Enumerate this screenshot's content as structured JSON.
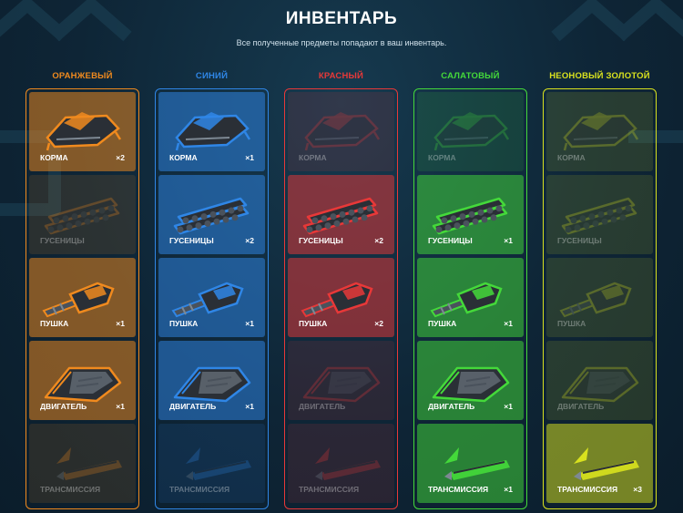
{
  "header": {
    "title": "ИНВЕНТАРЬ",
    "subtitle": "Все полученные предметы попадают в ваш инвентарь."
  },
  "columns": [
    {
      "label": "ОРАНЖЕВЫЙ",
      "color": "#f08a1e",
      "items": [
        {
          "name": "КОРМА",
          "count": "×2",
          "owned": true,
          "icon": "hull-icon"
        },
        {
          "name": "ГУСЕНИЦЫ",
          "count": "",
          "owned": false,
          "icon": "tracks-icon"
        },
        {
          "name": "ПУШКА",
          "count": "×1",
          "owned": true,
          "icon": "cannon-icon"
        },
        {
          "name": "ДВИГАТЕЛЬ",
          "count": "×1",
          "owned": true,
          "icon": "engine-icon"
        },
        {
          "name": "ТРАНСМИССИЯ",
          "count": "",
          "owned": false,
          "icon": "transmission-icon"
        }
      ]
    },
    {
      "label": "СИНИЙ",
      "color": "#2f86e6",
      "items": [
        {
          "name": "КОРМА",
          "count": "×1",
          "owned": true,
          "icon": "hull-icon"
        },
        {
          "name": "ГУСЕНИЦЫ",
          "count": "×2",
          "owned": true,
          "icon": "tracks-icon"
        },
        {
          "name": "ПУШКА",
          "count": "×1",
          "owned": true,
          "icon": "cannon-icon"
        },
        {
          "name": "ДВИГАТЕЛЬ",
          "count": "×1",
          "owned": true,
          "icon": "engine-icon"
        },
        {
          "name": "ТРАНСМИССИЯ",
          "count": "",
          "owned": false,
          "icon": "transmission-icon"
        }
      ]
    },
    {
      "label": "КРАСНЫЙ",
      "color": "#e83838",
      "items": [
        {
          "name": "КОРМА",
          "count": "",
          "owned": false,
          "icon": "hull-icon"
        },
        {
          "name": "ГУСЕНИЦЫ",
          "count": "×2",
          "owned": true,
          "icon": "tracks-icon"
        },
        {
          "name": "ПУШКА",
          "count": "×2",
          "owned": true,
          "icon": "cannon-icon"
        },
        {
          "name": "ДВИГАТЕЛЬ",
          "count": "",
          "owned": false,
          "icon": "engine-icon"
        },
        {
          "name": "ТРАНСМИССИЯ",
          "count": "",
          "owned": false,
          "icon": "transmission-icon"
        }
      ]
    },
    {
      "label": "САЛАТОВЫЙ",
      "color": "#44d93a",
      "items": [
        {
          "name": "КОРМА",
          "count": "",
          "owned": false,
          "icon": "hull-icon"
        },
        {
          "name": "ГУСЕНИЦЫ",
          "count": "×1",
          "owned": true,
          "icon": "tracks-icon"
        },
        {
          "name": "ПУШКА",
          "count": "×1",
          "owned": true,
          "icon": "cannon-icon"
        },
        {
          "name": "ДВИГАТЕЛЬ",
          "count": "×1",
          "owned": true,
          "icon": "engine-icon"
        },
        {
          "name": "ТРАНСМИССИЯ",
          "count": "×1",
          "owned": true,
          "icon": "transmission-icon"
        }
      ]
    },
    {
      "label": "НЕОНОВЫЙ ЗОЛОТОЙ",
      "color": "#d9e21e",
      "items": [
        {
          "name": "КОРМА",
          "count": "",
          "owned": false,
          "icon": "hull-icon"
        },
        {
          "name": "ГУСЕНИЦЫ",
          "count": "",
          "owned": false,
          "icon": "tracks-icon"
        },
        {
          "name": "ПУШКА",
          "count": "",
          "owned": false,
          "icon": "cannon-icon"
        },
        {
          "name": "ДВИГАТЕЛЬ",
          "count": "",
          "owned": false,
          "icon": "engine-icon"
        },
        {
          "name": "ТРАНСМИССИЯ",
          "count": "×3",
          "owned": true,
          "icon": "transmission-icon"
        }
      ]
    }
  ]
}
